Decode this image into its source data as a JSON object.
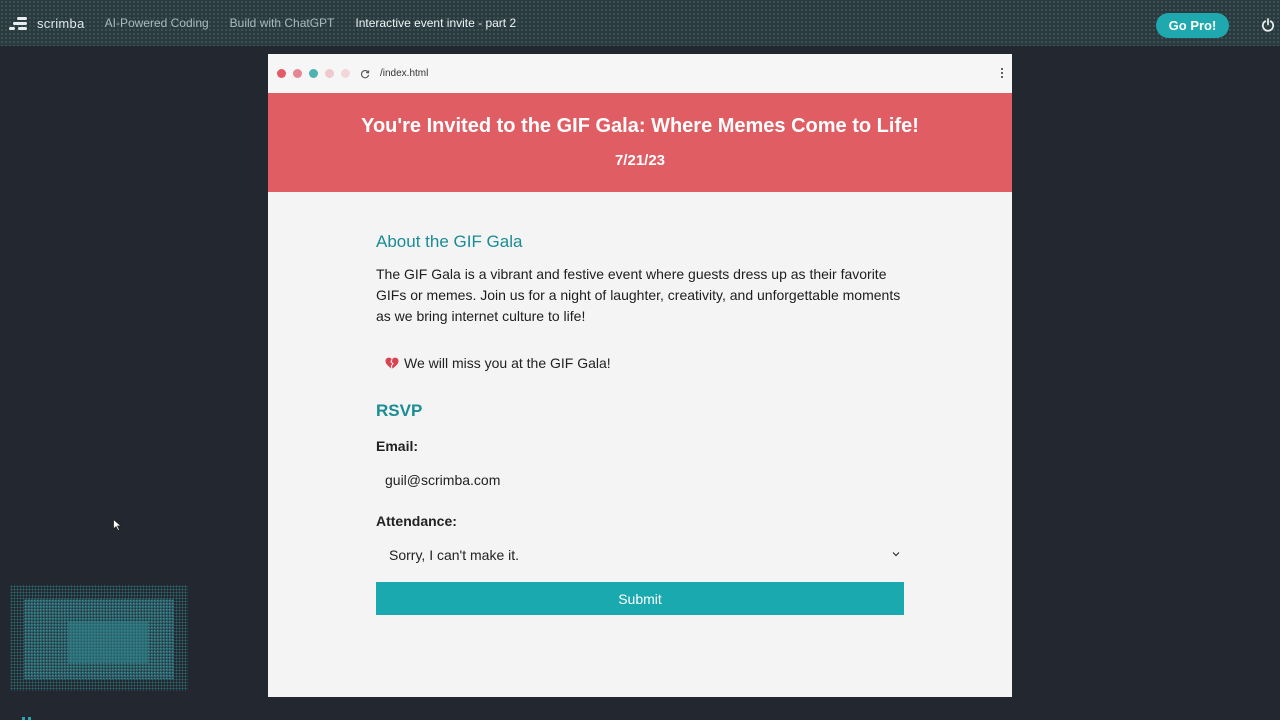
{
  "topbar": {
    "brand": "scrimba",
    "crumbs": [
      "AI-Powered Coding",
      "Build with ChatGPT",
      "Interactive event invite - part 2"
    ],
    "go_pro": "Go Pro!"
  },
  "browser": {
    "url": "/index.html"
  },
  "hero": {
    "title": "You're Invited to the GIF Gala: Where Memes Come to Life!",
    "date": "7/21/23"
  },
  "about": {
    "heading": "About the GIF Gala",
    "text": "The GIF Gala is a vibrant and festive event where guests dress up as their favorite GIFs or memes. Join us for a night of laughter, creativity, and unforgettable moments as we bring internet culture to life!"
  },
  "status_message": "We will miss you at the GIF Gala!",
  "rsvp": {
    "heading": "RSVP",
    "email_label": "Email:",
    "email_value": "guil@scrimba.com",
    "attendance_label": "Attendance:",
    "attendance_selected": "Sorry, I can't make it.",
    "submit_label": "Submit"
  },
  "colors": {
    "hero_bg": "#e15d64",
    "accent": "#19a9ae",
    "heading": "#1a8c95",
    "app_bg": "#232730"
  }
}
